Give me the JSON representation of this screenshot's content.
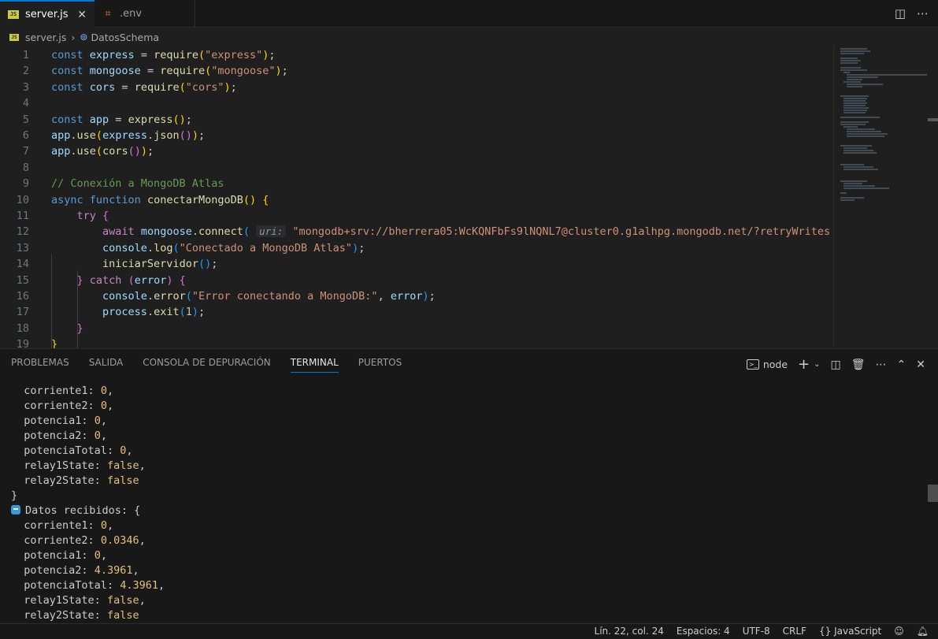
{
  "tabs": [
    {
      "label": "server.js",
      "icon": "js-file-icon",
      "active": true
    },
    {
      "label": ".env",
      "icon": "env-file-icon",
      "active": false
    }
  ],
  "breadcrumb": {
    "file": "server.js",
    "symbol": "DatosSchema"
  },
  "editor": {
    "lines": [
      {
        "n": "1"
      },
      {
        "n": "2"
      },
      {
        "n": "3"
      },
      {
        "n": "4"
      },
      {
        "n": "5"
      },
      {
        "n": "6"
      },
      {
        "n": "7"
      },
      {
        "n": "8"
      },
      {
        "n": "9"
      },
      {
        "n": "10"
      },
      {
        "n": "11"
      },
      {
        "n": "12"
      },
      {
        "n": "13"
      },
      {
        "n": "14"
      },
      {
        "n": "15"
      },
      {
        "n": "16"
      },
      {
        "n": "17"
      },
      {
        "n": "18"
      },
      {
        "n": "19"
      }
    ],
    "code": {
      "l1_kw": "const",
      "l1_var": "express",
      "l1_fn": "require",
      "l1_str": "\"express\"",
      "l2_kw": "const",
      "l2_var": "mongoose",
      "l2_fn": "require",
      "l2_str": "\"mongoose\"",
      "l3_kw": "const",
      "l3_var": "cors",
      "l3_fn": "require",
      "l3_str": "\"cors\"",
      "l5_kw": "const",
      "l5_var": "app",
      "l5_fn": "express",
      "l6_var": "app",
      "l6_fn": "use",
      "l6_var2": "express",
      "l6_fn2": "json",
      "l7_var": "app",
      "l7_fn": "use",
      "l7_fn2": "cors",
      "l9_cmt": "// Conexión a MongoDB Atlas",
      "l10_kw": "async",
      "l10_kw2": "function",
      "l10_fn": "conectarMongoDB",
      "l11_ctl": "try",
      "l12_ctl": "await",
      "l12_var": "mongoose",
      "l12_fn": "connect",
      "l12_hint": "uri:",
      "l12_str": "\"mongodb+srv://bherrera05:WcKQNFbFs9lNQNL7@cluster0.g1alhpg.mongodb.net/?retryWrites",
      "l13_var": "console",
      "l13_fn": "log",
      "l13_str": "\"Conectado a MongoDB Atlas\"",
      "l14_fn": "iniciarServidor",
      "l15_ctl": "catch",
      "l15_var": "error",
      "l16_var": "console",
      "l16_fn": "error",
      "l16_str": "\"Error conectando a MongoDB:\"",
      "l16_var2": "error",
      "l17_var": "process",
      "l17_fn": "exit",
      "l17_num": "1"
    }
  },
  "panel": {
    "tabs": [
      "PROBLEMAS",
      "SALIDA",
      "CONSOLA DE DEPURACIÓN",
      "TERMINAL",
      "PUERTOS"
    ],
    "active_tab": "TERMINAL",
    "terminal_name": "node"
  },
  "terminal": {
    "block1": [
      {
        "key": "corriente1",
        "val": "0"
      },
      {
        "key": "corriente2",
        "val": "0"
      },
      {
        "key": "potencia1",
        "val": "0"
      },
      {
        "key": "potencia2",
        "val": "0"
      },
      {
        "key": "potenciaTotal",
        "val": "0"
      },
      {
        "key": "relay1State",
        "val": "false"
      },
      {
        "key": "relay2State",
        "val": "false"
      }
    ],
    "close_brace": "}",
    "header": "Datos recibidos: {",
    "block2": [
      {
        "key": "corriente1",
        "val": "0"
      },
      {
        "key": "corriente2",
        "val": "0.0346"
      },
      {
        "key": "potencia1",
        "val": "0"
      },
      {
        "key": "potencia2",
        "val": "4.3961"
      },
      {
        "key": "potenciaTotal",
        "val": "4.3961"
      },
      {
        "key": "relay1State",
        "val": "false"
      },
      {
        "key": "relay2State",
        "val": "false"
      }
    ]
  },
  "statusbar": {
    "position": "Lín. 22, col. 24",
    "spaces": "Espacios: 4",
    "encoding": "UTF-8",
    "eol": "CRLF",
    "language": "JavaScript",
    "language_prefix": "{}"
  },
  "colors": {
    "accent": "#0078d4",
    "js_icon": "#cbcb41",
    "string": "#ce9178",
    "keyword": "#569cd6"
  }
}
